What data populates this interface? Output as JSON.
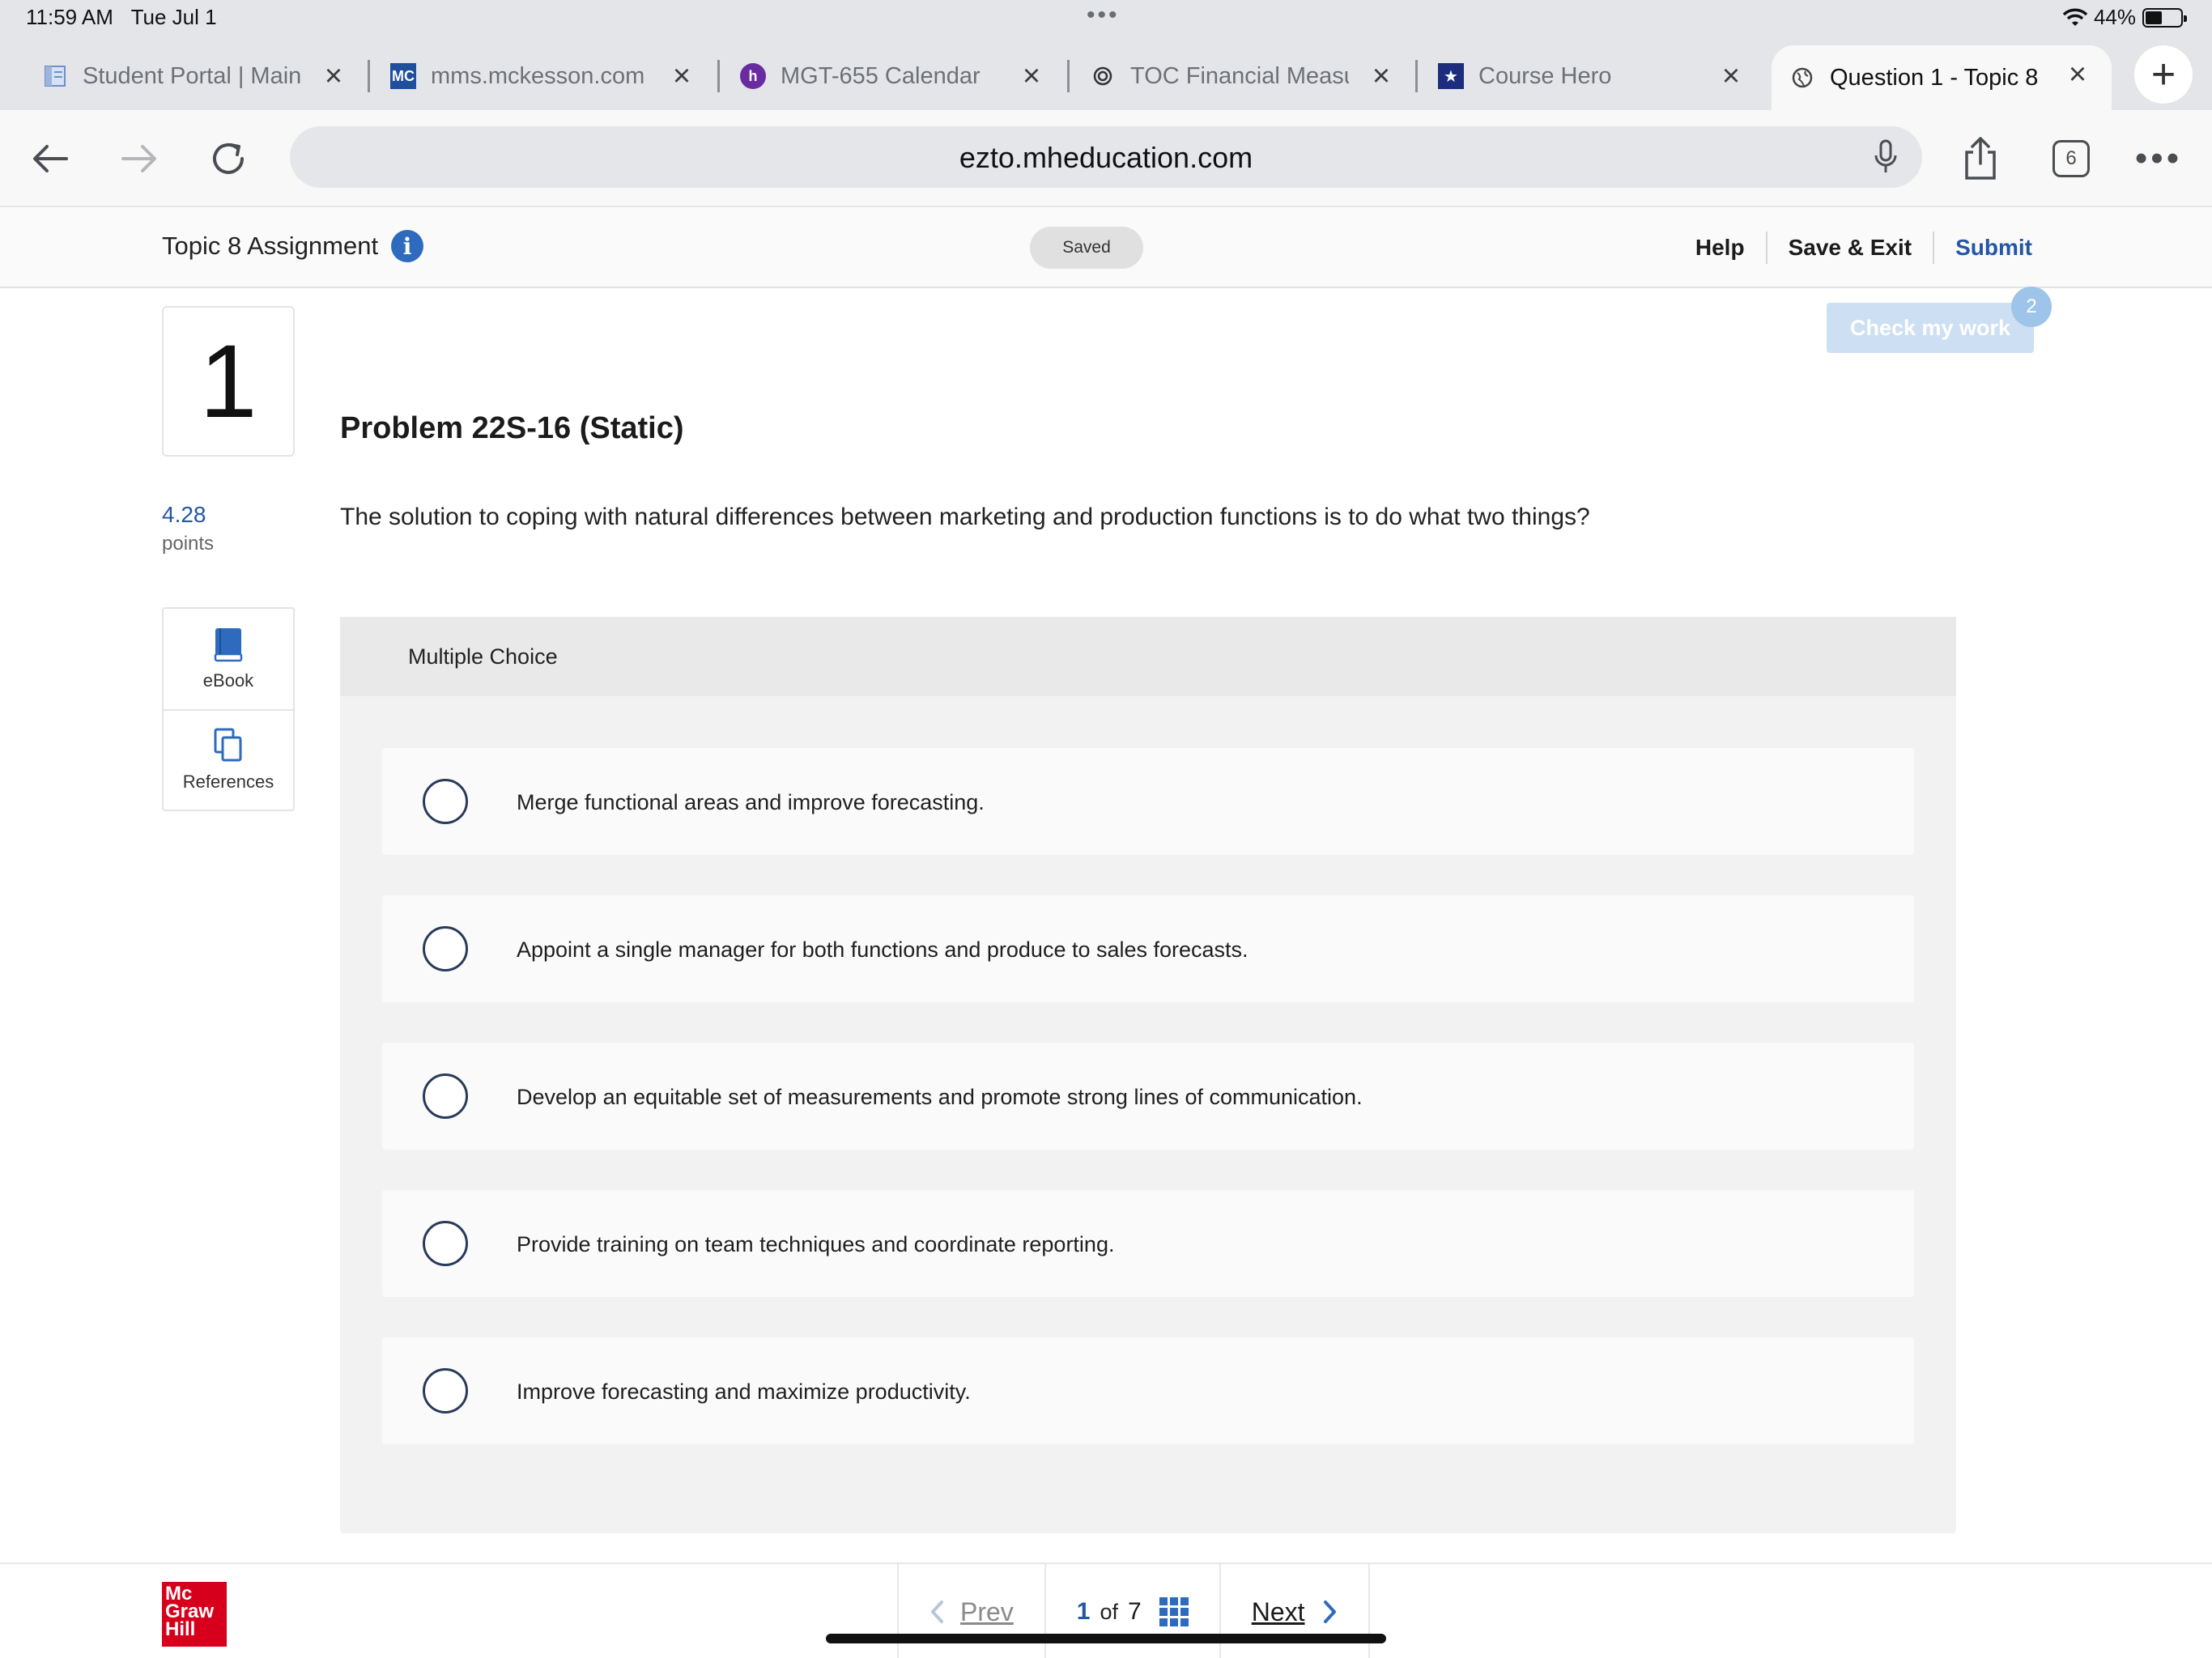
{
  "status_bar": {
    "time": "11:59 AM",
    "date": "Tue Jul 1",
    "dots": "•••",
    "battery": "44%",
    "battery_level": 0.44
  },
  "tabs": [
    {
      "title": "Student Portal | Main",
      "favicon": "document-icon",
      "active": false
    },
    {
      "title": "mms.mckesson.com",
      "favicon": "mckesson-icon",
      "favicon_text": "MC",
      "active": false
    },
    {
      "title": "MGT-655 Calendar",
      "favicon": "h-icon",
      "favicon_text": "h",
      "active": false
    },
    {
      "title": "TOC Financial Measu",
      "favicon": "openai-icon",
      "active": false
    },
    {
      "title": "Course Hero",
      "favicon": "coursehero-icon",
      "active": false
    },
    {
      "title": "Question 1 - Topic 8",
      "favicon": "globe-icon",
      "active": true
    }
  ],
  "browser": {
    "url": "ezto.mheducation.com",
    "tab_count": "6"
  },
  "assignment": {
    "title": "Topic 8 Assignment",
    "saved": "Saved",
    "links": {
      "help": "Help",
      "save_exit": "Save & Exit",
      "submit": "Submit"
    },
    "check_my_work": "Check my work",
    "check_badge": "2"
  },
  "question": {
    "number": "1",
    "problem_title": "Problem 22S-16 (Static)",
    "points_value": "4.28",
    "points_label": "points",
    "text": "The solution to coping with natural differences between marketing and production functions is to do what two things?",
    "type_label": "Multiple Choice",
    "choices": [
      "Merge functional areas and improve forecasting.",
      "Appoint a single manager for both functions and produce to sales forecasts.",
      "Develop an equitable set of measurements and promote strong lines of communication.",
      "Provide training on team techniques and coordinate reporting.",
      "Improve forecasting and maximize productivity."
    ]
  },
  "side_tools": {
    "ebook": "eBook",
    "references": "References"
  },
  "footer": {
    "logo_lines": [
      "Mc",
      "Graw",
      "Hill"
    ],
    "prev": "Prev",
    "next": "Next",
    "current_page": "1",
    "of_label": "of",
    "total_pages": "7"
  },
  "colors": {
    "accent": "#2356a3",
    "logo_red": "#d6001c",
    "check_button": "#cde0f3"
  }
}
